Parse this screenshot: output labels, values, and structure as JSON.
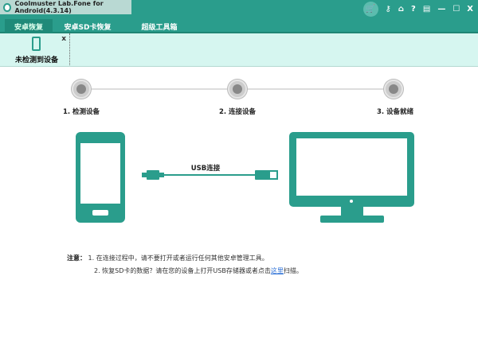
{
  "window": {
    "title": "Coolmuster Lab.Fone for Android(4.3.14)"
  },
  "controls": [
    "cart-icon",
    "key-icon",
    "home-icon",
    "help-icon",
    "register-icon",
    "minimize-icon",
    "maximize-icon",
    "close-icon"
  ],
  "tabs": [
    {
      "label": "安卓恢复",
      "active": true
    },
    {
      "label": "安卓SD卡恢复"
    },
    {
      "label": "超级工具箱"
    }
  ],
  "device": {
    "label": "未检测到设备",
    "close": "x"
  },
  "steps": [
    "1. 检测设备",
    "2. 连接设备",
    "3. 设备就绪"
  ],
  "cable_label": "USB连接",
  "notes": {
    "title": "注意：",
    "line1": "1. 在连接过程中，请不要打开或者运行任何其他安卓管理工具。",
    "line2_pre": "2. 恢复SD卡的数据？请在您的设备上打开USB存储器或者点击",
    "line2_link": "这里",
    "line2_post": "扫描。"
  },
  "colors": {
    "accent": "#2a9d8c",
    "panel": "#d6f6f0"
  }
}
